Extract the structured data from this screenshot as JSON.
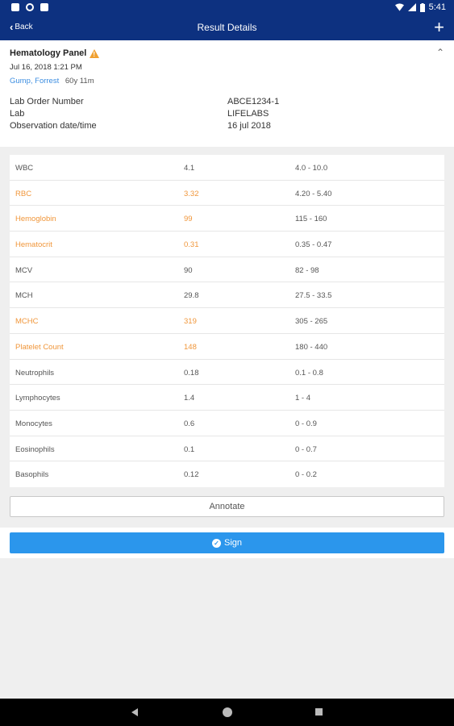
{
  "status_bar": {
    "time": "5:41",
    "icons": [
      "notification-icon",
      "sync-icon",
      "storage-icon",
      "wifi-icon",
      "signal-icon",
      "battery-icon"
    ]
  },
  "app_bar": {
    "back_label": "Back",
    "title": "Result Details",
    "add_label": "+"
  },
  "result": {
    "panel_name": "Hematology Panel",
    "datetime": "Jul 16, 2018 1:21 PM",
    "patient_name": "Gump, Forrest",
    "patient_age": "60y 11m",
    "info": [
      {
        "label": "Lab Order Number",
        "value": "ABCE1234-1"
      },
      {
        "label": "Lab",
        "value": "LIFELABS"
      },
      {
        "label": "Observation date/time",
        "value": "16 jul 2018"
      }
    ]
  },
  "tests": [
    {
      "name": "WBC",
      "value": "4.1",
      "range": "4.0 - 10.0",
      "abnormal": false
    },
    {
      "name": "RBC",
      "value": "3.32",
      "range": "4.20 - 5.40",
      "abnormal": true
    },
    {
      "name": "Hemoglobin",
      "value": "99",
      "range": "115 - 160",
      "abnormal": true
    },
    {
      "name": "Hematocrit",
      "value": "0.31",
      "range": "0.35 - 0.47",
      "abnormal": true
    },
    {
      "name": "MCV",
      "value": "90",
      "range": "82 - 98",
      "abnormal": false
    },
    {
      "name": "MCH",
      "value": "29.8",
      "range": "27.5 - 33.5",
      "abnormal": false
    },
    {
      "name": "MCHC",
      "value": "319",
      "range": "305 - 265",
      "abnormal": true
    },
    {
      "name": "Platelet Count",
      "value": "148",
      "range": "180 - 440",
      "abnormal": true
    },
    {
      "name": "Neutrophils",
      "value": "0.18",
      "range": "0.1 - 0.8",
      "abnormal": false
    },
    {
      "name": "Lymphocytes",
      "value": "1.4",
      "range": "1 - 4",
      "abnormal": false
    },
    {
      "name": "Monocytes",
      "value": "0.6",
      "range": "0 - 0.9",
      "abnormal": false
    },
    {
      "name": "Eosinophils",
      "value": "0.1",
      "range": "0 - 0.7",
      "abnormal": false
    },
    {
      "name": "Basophils",
      "value": "0.12",
      "range": "0 - 0.2",
      "abnormal": false
    }
  ],
  "actions": {
    "annotate_label": "Annotate",
    "sign_label": "Sign"
  },
  "colors": {
    "primary": "#0d3180",
    "abnormal": "#f0963a",
    "link": "#3b8de0",
    "sign": "#2b96ec"
  }
}
